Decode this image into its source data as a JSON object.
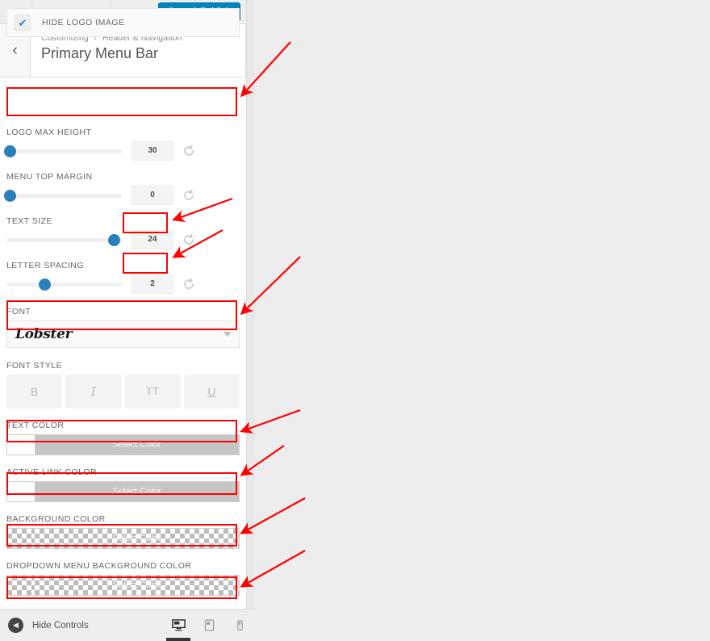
{
  "toolbar": {
    "close_label": "×",
    "collapse_label": "↑↓",
    "save_label": "Save & Publish",
    "accent_color": "#0085ba"
  },
  "section": {
    "back_label": "‹",
    "breadcrumb_root": "Customizing",
    "breadcrumb_separator": "›",
    "breadcrumb_parent": "Header & Navigation",
    "title": "Primary Menu Bar"
  },
  "controls": {
    "hide_logo": {
      "label": "HIDE LOGO IMAGE",
      "checked": true,
      "check_glyph": "✔"
    },
    "logo_max_height": {
      "label": "LOGO MAX HEIGHT",
      "value": "30",
      "handle_percent": 3
    },
    "menu_top_margin": {
      "label": "MENU TOP MARGIN",
      "value": "0",
      "handle_percent": 3
    },
    "text_size": {
      "label": "TEXT SIZE",
      "value": "24",
      "handle_percent": 93
    },
    "letter_spacing": {
      "label": "LETTER SPACING",
      "value": "2",
      "handle_percent": 33
    },
    "font": {
      "label": "FONT",
      "value": "Lobster"
    },
    "font_style": {
      "label": "FONT STYLE",
      "buttons": [
        {
          "name": "bold",
          "glyph": "B"
        },
        {
          "name": "italic",
          "glyph": "I"
        },
        {
          "name": "uppercase",
          "glyph": "TT"
        },
        {
          "name": "underline",
          "glyph": "U"
        }
      ]
    },
    "text_color": {
      "label": "TEXT COLOR",
      "button_label": "Select Color",
      "swatch": "#ffffff"
    },
    "active_link_color": {
      "label": "ACTIVE LINK COLOR",
      "button_label": "Select Color",
      "swatch": "#ffffff"
    },
    "background_color": {
      "label": "BACKGROUND COLOR",
      "button_label": "Select Color",
      "swatch": "transparent"
    },
    "dropdown_background_color": {
      "label": "DROPDOWN MENU BACKGROUND COLOR",
      "button_label": "Select Color",
      "swatch": "transparent"
    }
  },
  "bottom_bar": {
    "hide_controls_label": "Hide Controls",
    "devices": [
      {
        "name": "desktop",
        "active": true
      },
      {
        "name": "tablet",
        "active": false
      },
      {
        "name": "mobile",
        "active": false
      }
    ]
  },
  "annotations": {
    "highlight_color": "#ff0000",
    "arrow_color": "#ff0000",
    "count": 8
  }
}
